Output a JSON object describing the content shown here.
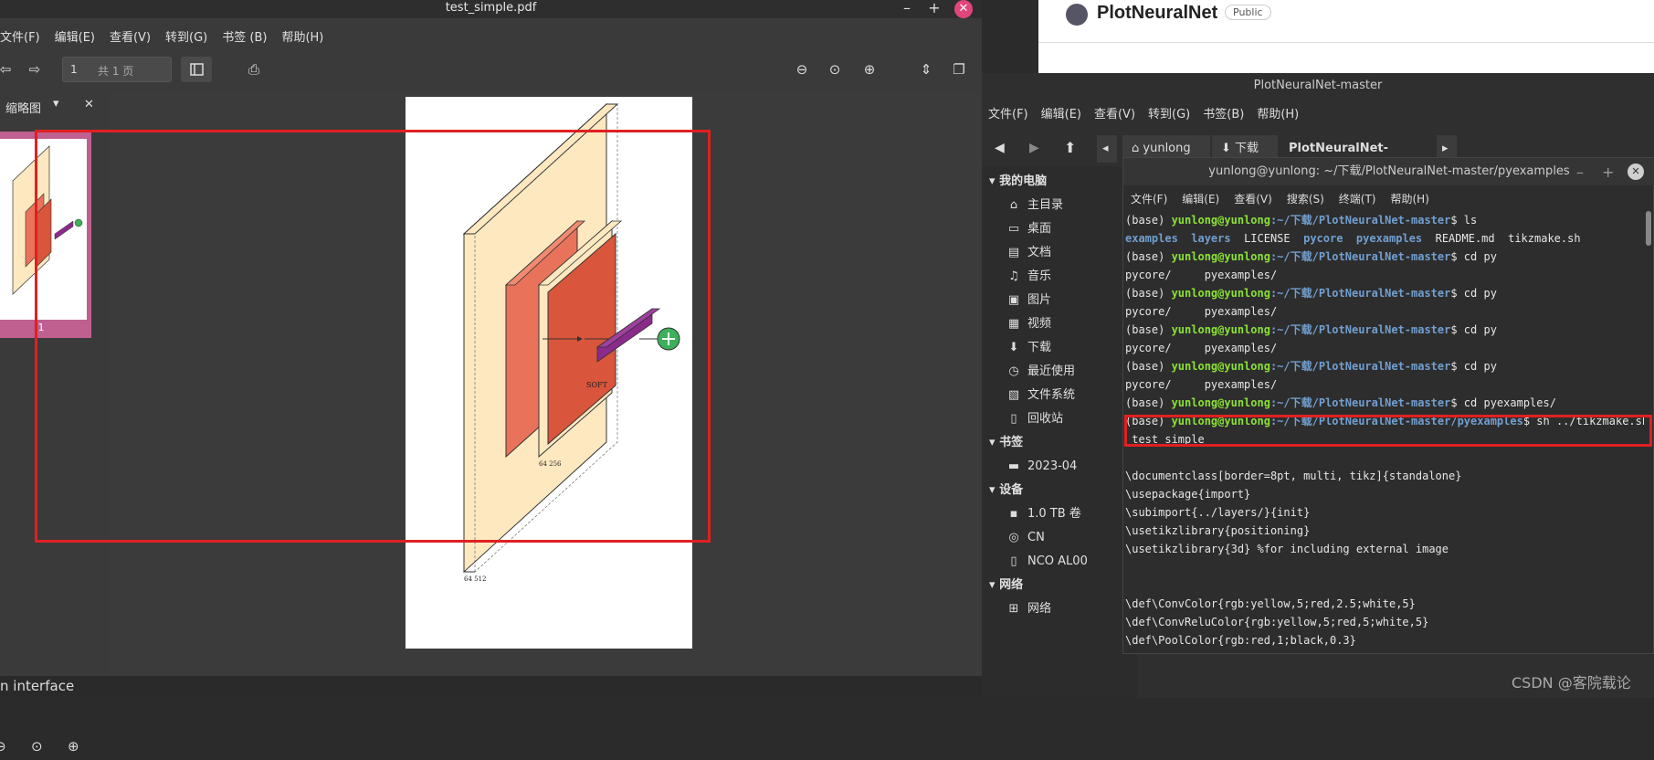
{
  "pdf_viewer": {
    "title": "test_simple.pdf",
    "menu": [
      "文件(F)",
      "编辑(E)",
      "查看(V)",
      "转到(G)",
      "书签 (B)",
      "帮助(H)"
    ],
    "page_number": "1",
    "page_total": "共 1 页",
    "sidebar_label": "缩略图",
    "thumb_page_label": "1",
    "figure_labels": {
      "big": "64 512",
      "mid": "64 256",
      "soft": "SOFT"
    },
    "status": "n interface"
  },
  "github": {
    "repo": "PlotNeuralNet",
    "badge": "Public"
  },
  "file_manager": {
    "title": "PlotNeuralNet-master",
    "menu": [
      "文件(F)",
      "编辑(E)",
      "查看(V)",
      "转到(G)",
      "书签(B)",
      "帮助(H)"
    ],
    "crumbs": [
      "yunlong",
      "下载",
      "PlotNeuralNet-master"
    ],
    "sidebar": [
      {
        "type": "head",
        "label": "我的电脑"
      },
      {
        "type": "item",
        "icon": "⌂",
        "label": "主目录"
      },
      {
        "type": "item",
        "icon": "▭",
        "label": "桌面"
      },
      {
        "type": "item",
        "icon": "▤",
        "label": "文档"
      },
      {
        "type": "item",
        "icon": "♫",
        "label": "音乐"
      },
      {
        "type": "item",
        "icon": "▣",
        "label": "图片"
      },
      {
        "type": "item",
        "icon": "▦",
        "label": "视频"
      },
      {
        "type": "item",
        "icon": "⬇",
        "label": "下载"
      },
      {
        "type": "item",
        "icon": "◷",
        "label": "最近使用"
      },
      {
        "type": "item",
        "icon": "▧",
        "label": "文件系统"
      },
      {
        "type": "item",
        "icon": "▯",
        "label": "回收站"
      },
      {
        "type": "head",
        "label": "书签"
      },
      {
        "type": "item",
        "icon": "▬",
        "label": "2023-04"
      },
      {
        "type": "head",
        "label": "设备"
      },
      {
        "type": "item",
        "icon": "▪",
        "label": "1.0 TB 卷"
      },
      {
        "type": "item",
        "icon": "◎",
        "label": "CN"
      },
      {
        "type": "item",
        "icon": "▯",
        "label": "NCO AL00"
      },
      {
        "type": "head",
        "label": "网络"
      },
      {
        "type": "item",
        "icon": "⊞",
        "label": "网络"
      }
    ]
  },
  "terminal": {
    "title": "yunlong@yunlong: ~/下载/PlotNeuralNet-master/pyexamples",
    "menu": [
      "文件(F)",
      "编辑(E)",
      "查看(V)",
      "搜索(S)",
      "终端(T)",
      "帮助(H)"
    ],
    "prompt_base": "(base) ",
    "prompt_user": "yunlong@yunlong",
    "prompt_path": ":~/下载/PlotNeuralNet-master",
    "prompt_path_py": ":~/下载/PlotNeuralNet-master/pyexamples",
    "lines": [
      {
        "kind": "cmd",
        "cmd": "$ ls"
      },
      {
        "kind": "ls"
      },
      {
        "kind": "cmd",
        "cmd": "$ cd py"
      },
      {
        "kind": "out",
        "text": "pycore/     pyexamples/"
      },
      {
        "kind": "cmd",
        "cmd": "$ cd py"
      },
      {
        "kind": "out",
        "text": "pycore/     pyexamples/"
      },
      {
        "kind": "cmd",
        "cmd": "$ cd py"
      },
      {
        "kind": "out",
        "text": "pycore/     pyexamples/"
      },
      {
        "kind": "cmd",
        "cmd": "$ cd py"
      },
      {
        "kind": "out",
        "text": "pycore/     pyexamples/"
      },
      {
        "kind": "cmd",
        "cmd": "$ cd pyexamples/"
      },
      {
        "kind": "cmdpy",
        "cmd": "$ sh ../tikzmake.sh"
      },
      {
        "kind": "out",
        "text": " test_simple"
      },
      {
        "kind": "out",
        "text": ""
      },
      {
        "kind": "out",
        "text": "\\documentclass[border=8pt, multi, tikz]{standalone}"
      },
      {
        "kind": "out",
        "text": "\\usepackage{import}"
      },
      {
        "kind": "out",
        "text": "\\subimport{../layers/}{init}"
      },
      {
        "kind": "out",
        "text": "\\usetikzlibrary{positioning}"
      },
      {
        "kind": "out",
        "text": "\\usetikzlibrary{3d} %for including external image"
      },
      {
        "kind": "out",
        "text": ""
      },
      {
        "kind": "out",
        "text": ""
      },
      {
        "kind": "out",
        "text": "\\def\\ConvColor{rgb:yellow,5;red,2.5;white,5}"
      },
      {
        "kind": "out",
        "text": "\\def\\ConvReluColor{rgb:yellow,5;red,5;white,5}"
      },
      {
        "kind": "out",
        "text": "\\def\\PoolColor{rgb:red,1;black,0.3}"
      }
    ],
    "ls_items": [
      {
        "text": "examples",
        "dir": true
      },
      {
        "text": "layers",
        "dir": true
      },
      {
        "text": "LICENSE",
        "dir": false
      },
      {
        "text": "pycore",
        "dir": true
      },
      {
        "text": "pyexamples",
        "dir": true
      },
      {
        "text": "README.md",
        "dir": false
      },
      {
        "text": "tikzmake.sh",
        "dir": false
      }
    ]
  },
  "watermark": "CSDN @客院载论"
}
